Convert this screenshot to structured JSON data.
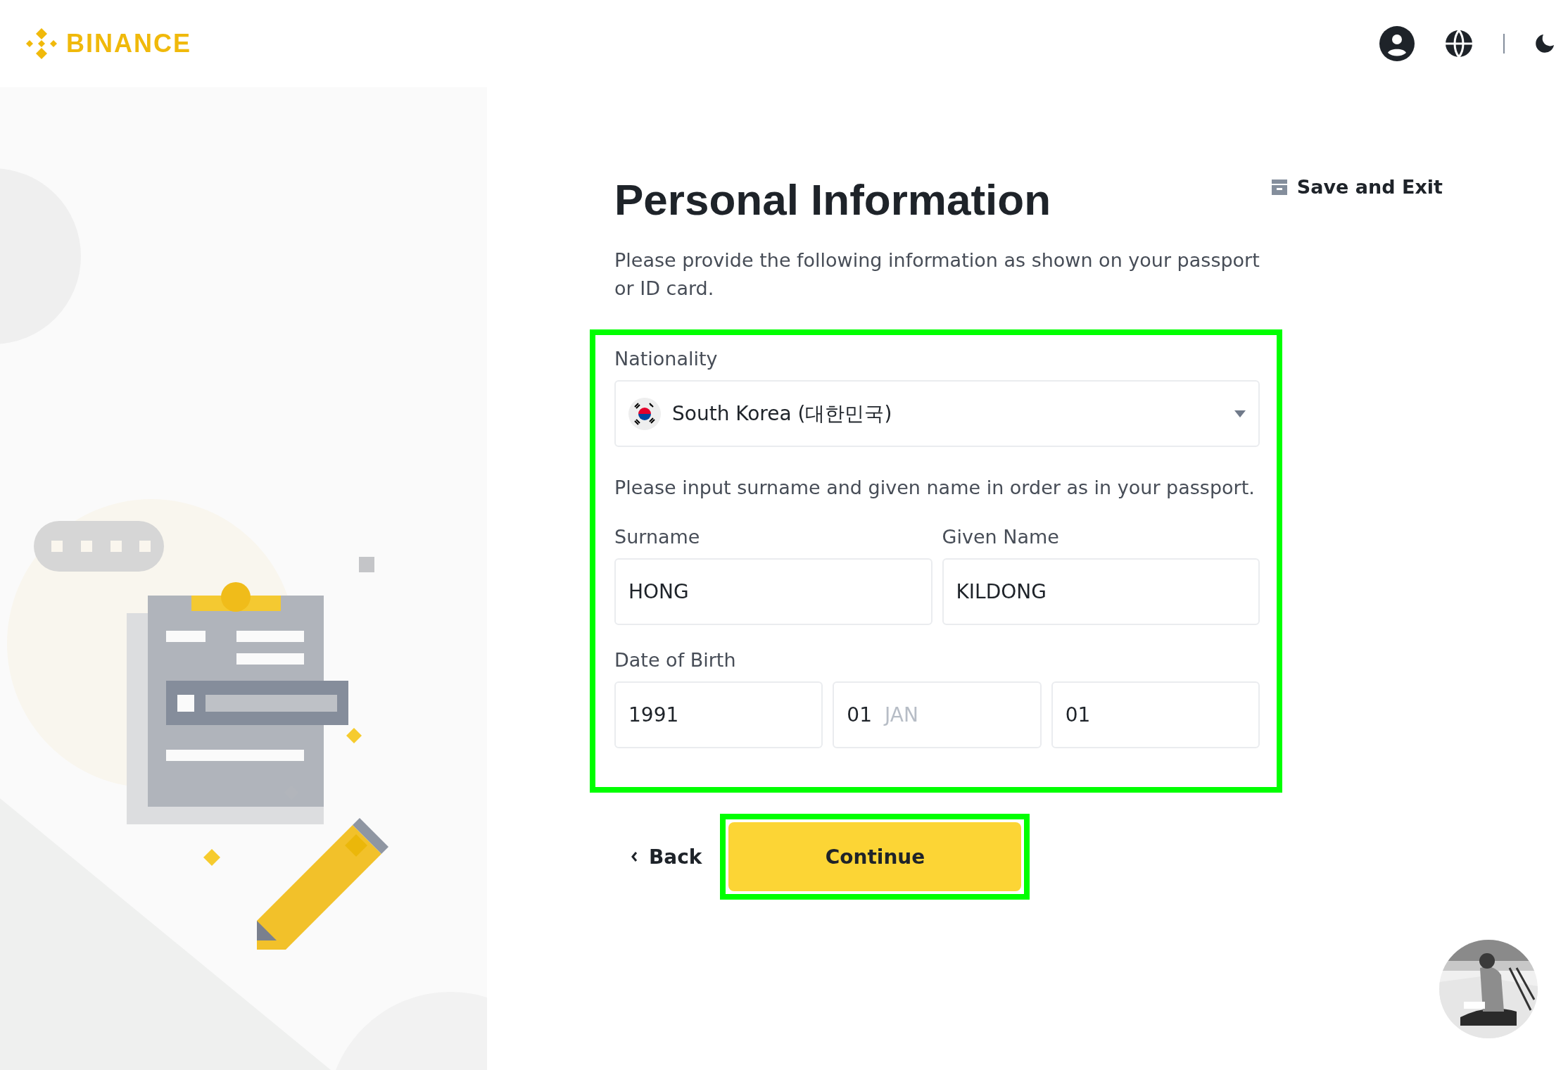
{
  "header": {
    "logo": "BINANCE"
  },
  "title": "Personal Information",
  "save_exit": "Save and Exit",
  "description": "Please provide the following information as shown on your passport or ID card.",
  "form": {
    "highlighted": true,
    "nationality": {
      "label": "Nationality",
      "value": "South Korea (대한민국)"
    },
    "instruction": "Please input surname and given name in order as in your passport.",
    "names": [
      {
        "label": "Surname",
        "value": "HONG"
      },
      {
        "label": "Given Name",
        "value": "KILDONG"
      }
    ],
    "date_of_birth": {
      "label": "Date of Birth",
      "fields": [
        {
          "value": "1991"
        },
        {
          "value": "01",
          "hint": "JAN"
        },
        {
          "value": "01"
        }
      ]
    }
  },
  "back": "Back",
  "continue": {
    "label": "Continue",
    "highlighted": true
  }
}
